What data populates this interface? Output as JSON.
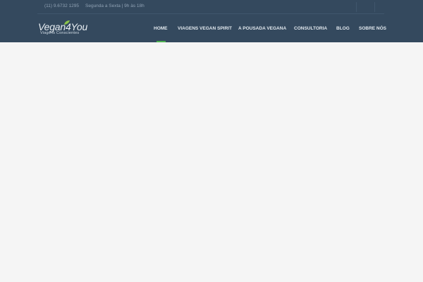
{
  "topbar": {
    "phone": "(11) 9.6732 1295",
    "hours": "Segunda a Sexta | 9h às 18h"
  },
  "logo": {
    "name": "Vegan4You",
    "tagline": "Viagens Conscientes"
  },
  "nav": {
    "items": [
      {
        "label": "HOME",
        "active": true
      },
      {
        "label": "VIAGENS VEGAN SPIRIT",
        "active": false
      },
      {
        "label": "A POUSADA VEGANA",
        "active": false
      },
      {
        "label": "CONSULTORIA",
        "active": false
      },
      {
        "label": "BLOG",
        "active": false
      },
      {
        "label": "SOBRE NÓS",
        "active": false
      }
    ]
  },
  "colors": {
    "header_bg": "#34495e",
    "nav_active": "#4caf50",
    "page_bg": "#f5f5f5"
  }
}
